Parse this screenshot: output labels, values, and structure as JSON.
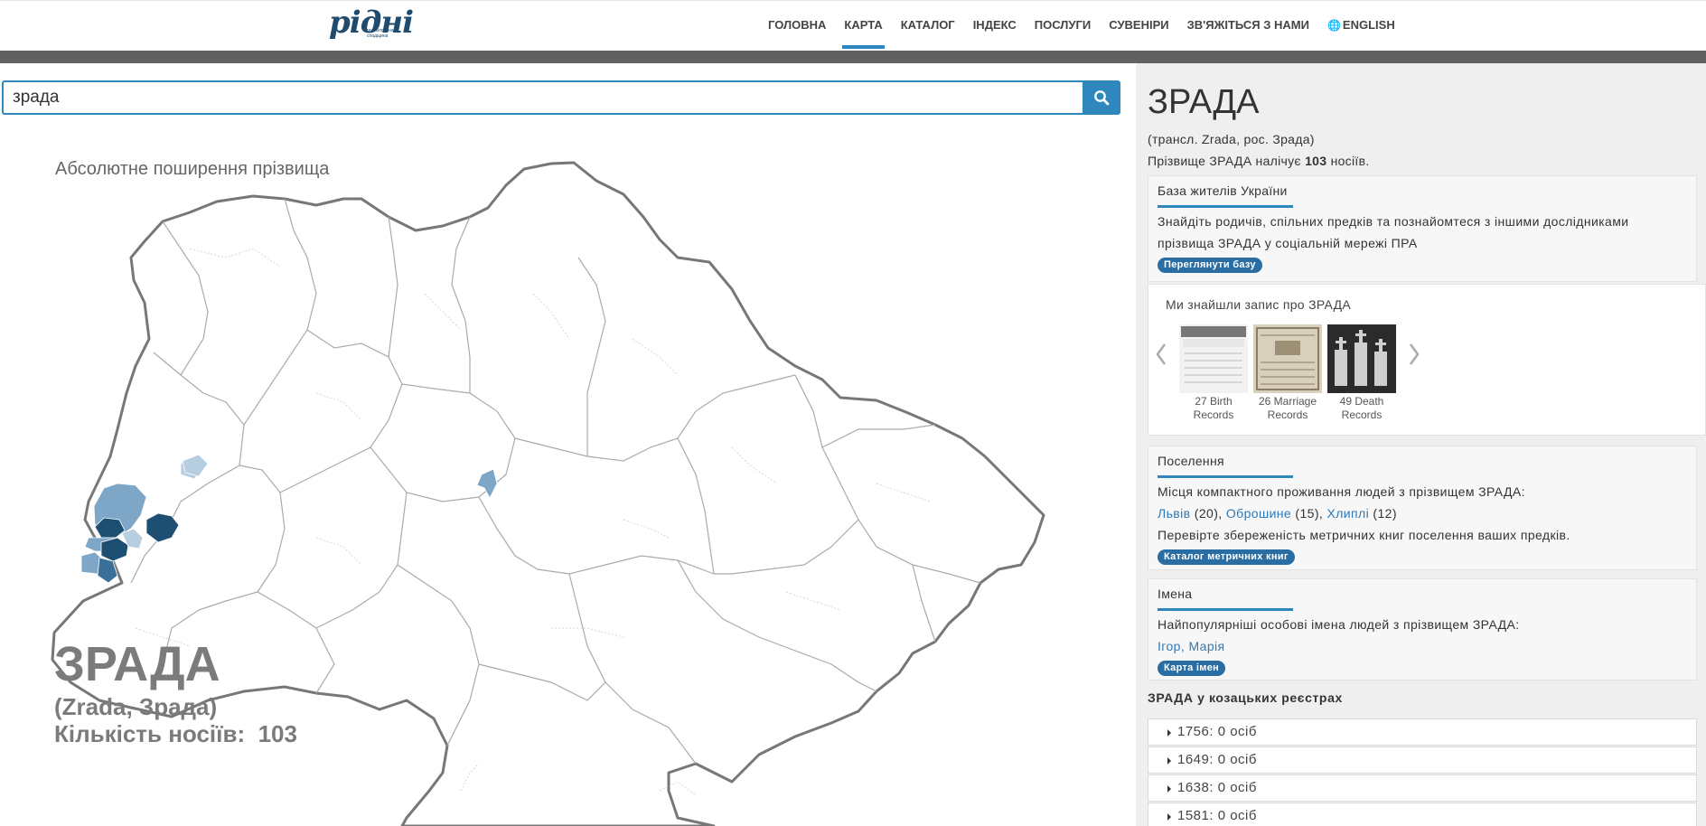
{
  "header": {
    "logo_text": "рідні",
    "logo_sub": "генеалогічна спадщина",
    "nav": [
      {
        "label": "ГОЛОВНА",
        "active": false
      },
      {
        "label": "КАРТА",
        "active": true
      },
      {
        "label": "КАТАЛОГ",
        "active": false
      },
      {
        "label": "ІНДЕКС",
        "active": false
      },
      {
        "label": "ПОСЛУГИ",
        "active": false
      },
      {
        "label": "СУВЕНІРИ",
        "active": false
      },
      {
        "label": "ЗВ'ЯЖІТЬСЯ З НАМИ",
        "active": false
      },
      {
        "label": "ENGLISH",
        "active": false
      }
    ]
  },
  "search": {
    "value": "зрада",
    "icon": "search-icon"
  },
  "map": {
    "title": "Абсолютне поширення прізвища",
    "surname": "ЗРАДА",
    "transliteration": "(Zrada, Зрада)",
    "count_label": "Кількість носіїв:",
    "count": "103",
    "colors": {
      "dark": "#1d4f73",
      "mid": "#3a6f99",
      "light": "#7ea6c6",
      "pale": "#b7cde0",
      "border": "#777777"
    }
  },
  "panel": {
    "title": "ЗРАДА",
    "trans": "(трансл. Zrada, рос. Зрада)",
    "count_prefix": "Прізвище ЗРАДА налічує",
    "count": "103",
    "count_suffix": "носіїв.",
    "base": {
      "heading": "База жителів України",
      "text1": "Знайдіть родичів, спільних предків та познайомтеся з іншими дослідниками",
      "text2": "прізвища ЗРАДА у соціальній мережі ПРА",
      "button": "Переглянути базу"
    },
    "records": {
      "heading": "Ми знайшли запис про ЗРАДА",
      "items": [
        {
          "l1": "27 Birth",
          "l2": "Records"
        },
        {
          "l1": "26 Marriage",
          "l2": "Records"
        },
        {
          "l1": "49 Death",
          "l2": "Records"
        }
      ]
    },
    "settlements": {
      "heading": "Поселення",
      "text": "Місця компактного проживання людей з прізвищем ЗРАДА:",
      "places": [
        {
          "name": "Львів",
          "count": "(20)"
        },
        {
          "name": "Оброшине",
          "count": "(15)"
        },
        {
          "name": "Хлиплі",
          "count": "(12)"
        }
      ],
      "text2": "Перевірте збереженість метричних книг поселення ваших предків.",
      "button": "Каталог метричних книг"
    },
    "names": {
      "heading": "Імена",
      "text": "Найпопулярніші особові імена людей з прізвищем ЗРАДА:",
      "list": "Ігор, Марія",
      "button": "Карта імен"
    },
    "cossack": {
      "heading": "ЗРАДА у козацьких реєстрах",
      "rows": [
        "1756: 0 осіб",
        "1649: 0 осіб",
        "1638: 0 осіб",
        "1581: 0 осіб"
      ]
    }
  }
}
